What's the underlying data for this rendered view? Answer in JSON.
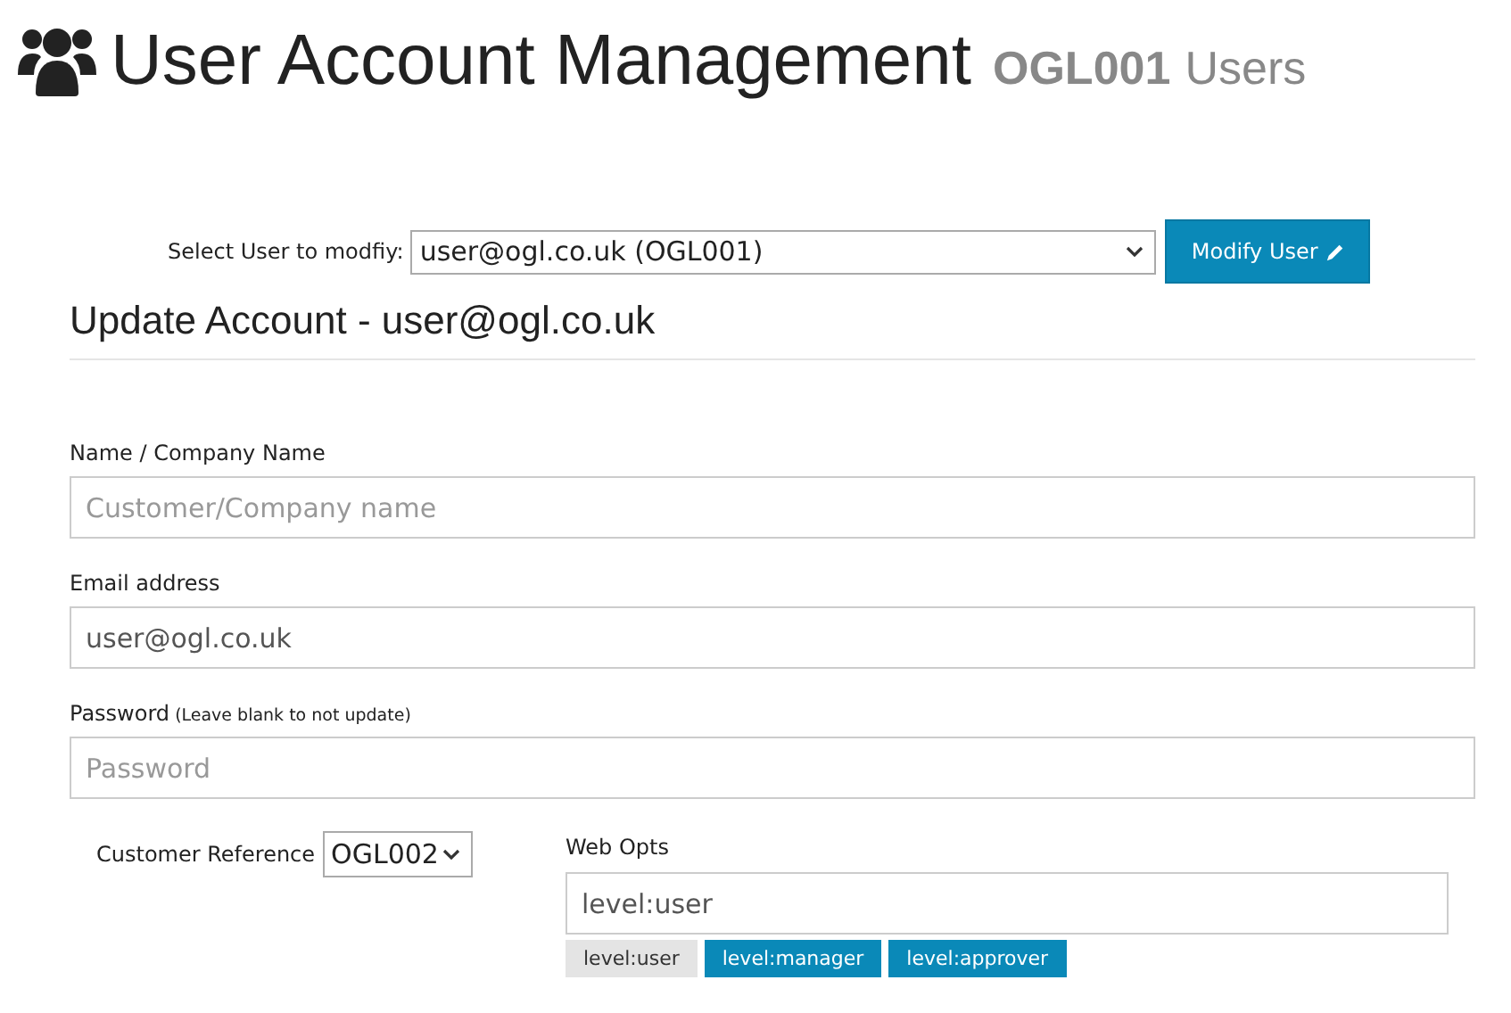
{
  "page_title": {
    "text": "User Account Management",
    "account": "OGL001",
    "suffix": "Users"
  },
  "user_select": {
    "label": "Select User to modfiy:",
    "value": "user@ogl.co.uk (OGL001)",
    "button": "Modify User"
  },
  "section_heading": "Update Account - user@ogl.co.uk",
  "fields": [
    {
      "label": "Name / Company Name",
      "placeholder": "Customer/Company name"
    },
    {
      "label": "Email address",
      "value": "user@ogl.co.uk"
    },
    {
      "label": "Password",
      "hint": "(Leave blank to not update)",
      "placeholder": "Password"
    }
  ],
  "customer_reference": {
    "label": "Customer Reference",
    "value": "OGL002"
  },
  "web_opts": {
    "label": "Web Opts",
    "value": "level:user",
    "options": [
      {
        "label": "level:user",
        "selected": true
      },
      {
        "label": "level:manager",
        "selected": false
      },
      {
        "label": "level:approver",
        "selected": false
      }
    ]
  }
}
